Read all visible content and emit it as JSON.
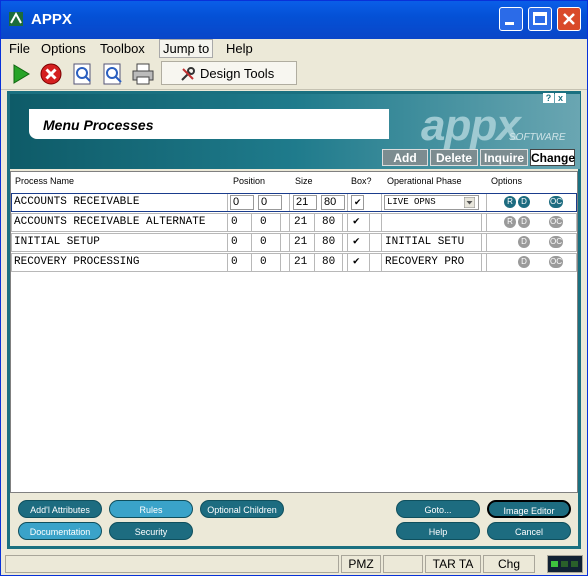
{
  "window": {
    "title": "APPX"
  },
  "menu": [
    "File",
    "Options",
    "Toolbox",
    "Jump to",
    "Help"
  ],
  "toolbar": {
    "design_tools": "Design Tools"
  },
  "header": {
    "title": "Menu Processes",
    "logo": "appx",
    "logo_sub": "SOFTWARE",
    "help_icon": "?",
    "close_icon": "x"
  },
  "actions": [
    "Add",
    "Delete",
    "Inquire",
    "Change"
  ],
  "columns": {
    "process_name": "Process Name",
    "position": "Position",
    "size": "Size",
    "box": "Box?",
    "phase": "Operational Phase",
    "options": "Options"
  },
  "rows": [
    {
      "name": "ACCOUNTS RECEIVABLE",
      "pos1": "0",
      "pos2": "0",
      "size1": "21",
      "size2": "80",
      "box": "✔",
      "phase": "LIVE OPNS",
      "opts": [
        "R",
        "D",
        "OC"
      ],
      "opt_state": [
        "on",
        "on",
        "on"
      ]
    },
    {
      "name": "ACCOUNTS RECEIVABLE ALTERNATE",
      "pos1": "0",
      "pos2": "0",
      "size1": "21",
      "size2": "80",
      "box": "✔",
      "phase": "",
      "opts": [
        "R",
        "D",
        "OC"
      ],
      "opt_state": [
        "off",
        "off",
        "off"
      ]
    },
    {
      "name": "INITIAL SETUP",
      "pos1": "0",
      "pos2": "0",
      "size1": "21",
      "size2": "80",
      "box": "✔",
      "phase": "INITIAL SETU",
      "opts": [
        "D",
        "OC"
      ],
      "opt_state": [
        "off",
        "off"
      ]
    },
    {
      "name": "RECOVERY PROCESSING",
      "pos1": "0",
      "pos2": "0",
      "size1": "21",
      "size2": "80",
      "box": "✔",
      "phase": "RECOVERY PRO",
      "opts": [
        "D",
        "OC"
      ],
      "opt_state": [
        "off",
        "off"
      ]
    }
  ],
  "buttons": {
    "addl_attributes": "Add'l Attributes",
    "rules": "Rules",
    "optional_children": "Optional Children",
    "documentation": "Documentation",
    "security": "Security",
    "goto": "Goto...",
    "image_editor": "Image Editor",
    "help": "Help",
    "cancel": "Cancel"
  },
  "status": {
    "pmz": "PMZ",
    "tar": "TAR TA",
    "chg": "Chg"
  },
  "colors": {
    "teal": "#1a7080",
    "titlebar": "#0451d6"
  }
}
